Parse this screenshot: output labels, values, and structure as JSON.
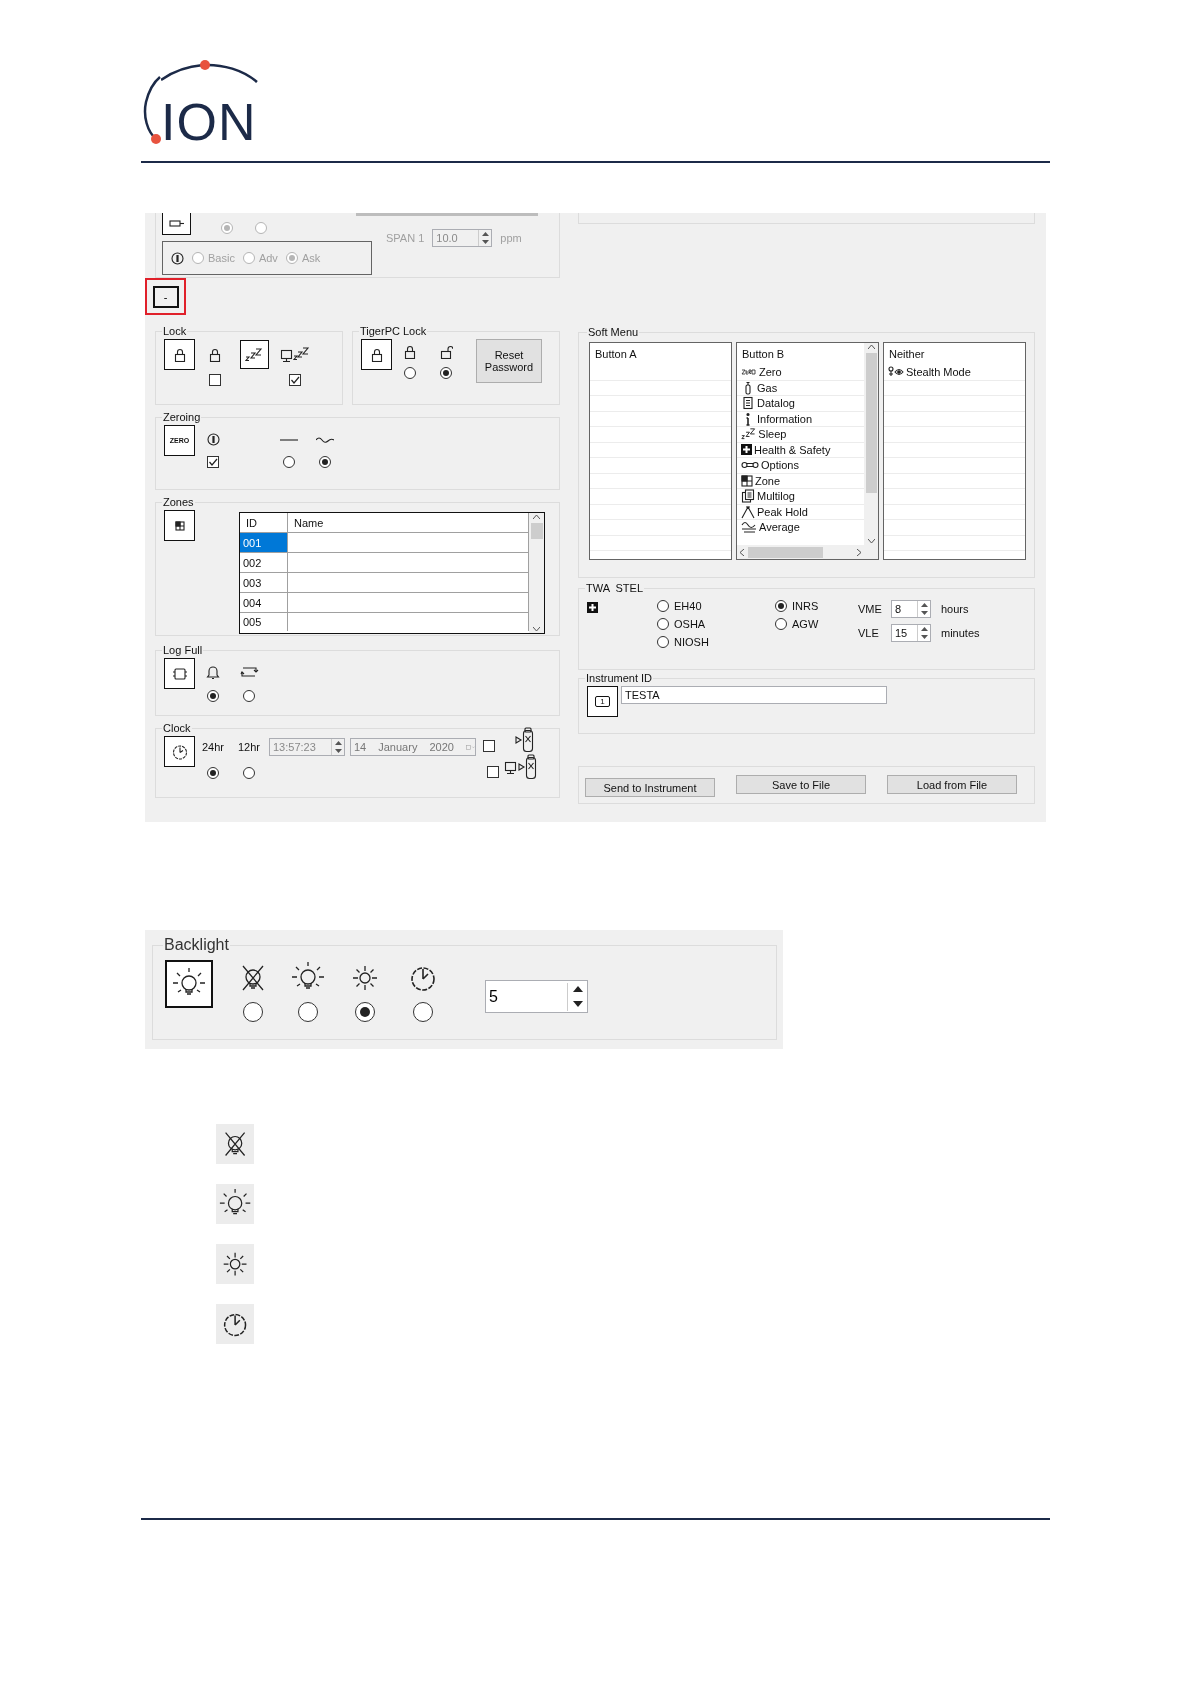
{
  "logo": {
    "text": "ION"
  },
  "settings_window": {
    "calibration_fragment": {
      "radios": [
        {
          "selected": true
        },
        {
          "selected": false
        }
      ],
      "mode_options": [
        {
          "label": "Basic",
          "selected": false
        },
        {
          "label": "Adv",
          "selected": false
        },
        {
          "label": "Ask",
          "selected": true
        }
      ],
      "span_label": "SPAN 1",
      "span_value": "10.0",
      "span_unit": "ppm"
    },
    "collapse_button": {
      "label": "-"
    },
    "lock": {
      "title": "Lock",
      "lock_checked": false,
      "sleep_checked": true
    },
    "tigerpc_lock": {
      "title": "TigerPC Lock",
      "options": [
        {
          "selected": false
        },
        {
          "selected": true
        }
      ],
      "reset_button": "Reset Password"
    },
    "zeroing": {
      "title": "Zeroing",
      "icon_label": "ZERO",
      "checked": true,
      "options": [
        {
          "selected": false
        },
        {
          "selected": true
        }
      ]
    },
    "zones": {
      "title": "Zones",
      "columns": [
        "ID",
        "Name"
      ],
      "rows": [
        {
          "id": "001",
          "selected": true
        },
        {
          "id": "002",
          "selected": false
        },
        {
          "id": "003",
          "selected": false
        },
        {
          "id": "004",
          "selected": false
        },
        {
          "id": "005",
          "selected": false
        }
      ]
    },
    "log_full": {
      "title": "Log Full",
      "options": [
        {
          "selected": true
        },
        {
          "selected": false
        }
      ]
    },
    "clock": {
      "title": "Clock",
      "formats": [
        {
          "label": "24hr",
          "selected": true
        },
        {
          "label": "12hr",
          "selected": false
        }
      ],
      "time": "13:57:23",
      "date": {
        "day": "14",
        "month": "January",
        "year": "2020"
      },
      "sync_instrument_checked": false,
      "sync_pc_checked": false
    },
    "soft_menu": {
      "title": "Soft Menu",
      "lists": [
        {
          "header": "Button A"
        },
        {
          "header": "Button B",
          "items": [
            {
              "label": "Zero",
              "kind": "zero"
            },
            {
              "label": "Gas",
              "kind": "gas"
            },
            {
              "label": "Datalog",
              "kind": "datalog"
            },
            {
              "label": "Information",
              "kind": "info"
            },
            {
              "label": "Sleep",
              "kind": "sleep"
            },
            {
              "label": "Health & Safety",
              "kind": "health"
            },
            {
              "label": "Options",
              "kind": "options"
            },
            {
              "label": "Zone",
              "kind": "zone"
            },
            {
              "label": "Multilog",
              "kind": "multilog"
            },
            {
              "label": "Peak Hold",
              "kind": "peak"
            },
            {
              "label": "Average",
              "kind": "average"
            }
          ]
        },
        {
          "header": "Neither",
          "items": [
            {
              "label": "Stealth Mode",
              "kind": "stealth"
            }
          ]
        }
      ]
    },
    "twa_stel": {
      "title": "TWA  STEL",
      "columns": [
        {
          "options": [
            {
              "label": "EH40",
              "selected": false
            },
            {
              "label": "OSHA",
              "selected": false
            },
            {
              "label": "NIOSH",
              "selected": false
            }
          ]
        },
        {
          "options": [
            {
              "label": "INRS",
              "selected": true
            },
            {
              "label": "AGW",
              "selected": false
            }
          ]
        }
      ],
      "limits": [
        {
          "label": "VME",
          "value": "8",
          "unit": "hours"
        },
        {
          "label": "VLE",
          "value": "15",
          "unit": "minutes"
        }
      ]
    },
    "instrument_id": {
      "title": "Instrument ID",
      "icon_label": "1",
      "value": "TESTA"
    },
    "buttons": [
      "Send to Instrument",
      "Save to File",
      "Load from File"
    ]
  },
  "backlight_window": {
    "title": "Backlight",
    "options": [
      {
        "kind": "off",
        "selected": false
      },
      {
        "kind": "bulb",
        "selected": false
      },
      {
        "kind": "sun",
        "selected": true
      },
      {
        "kind": "timer",
        "selected": false
      }
    ],
    "timeout": "5"
  },
  "legend_icons": [
    {
      "kind": "off"
    },
    {
      "kind": "bulb"
    },
    {
      "kind": "sun"
    },
    {
      "kind": "timer"
    }
  ]
}
